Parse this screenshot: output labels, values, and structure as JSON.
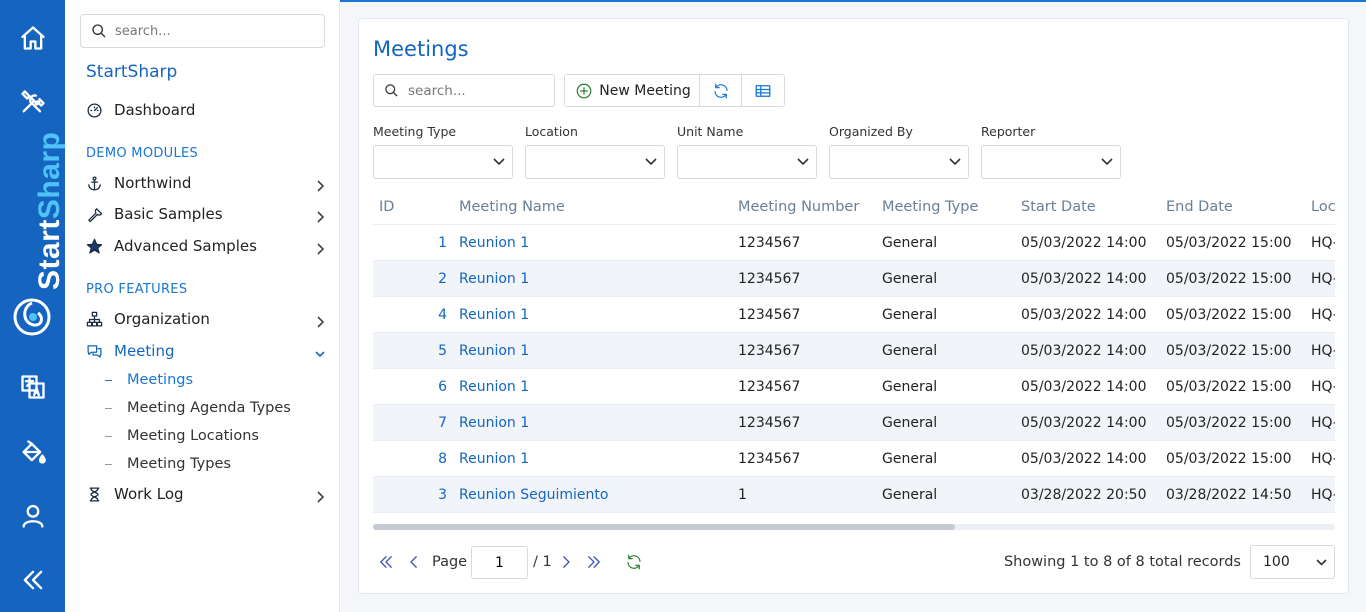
{
  "brand": {
    "name_part1": "Start",
    "name_part2": "Sharp"
  },
  "sidebar": {
    "search_placeholder": "search...",
    "app_title": "StartSharp",
    "dashboard_label": "Dashboard",
    "demo_header": "DEMO MODULES",
    "pro_header": "PRO FEATURES",
    "items": [
      {
        "label": "Northwind",
        "icon": "anchor-icon"
      },
      {
        "label": "Basic Samples",
        "icon": "wrench-icon"
      },
      {
        "label": "Advanced Samples",
        "icon": "star-icon"
      },
      {
        "label": "Organization",
        "icon": "sitemap-icon"
      },
      {
        "label": "Meeting",
        "icon": "comments-icon",
        "expanded": true
      },
      {
        "label": "Work Log",
        "icon": "hourglass-icon"
      }
    ],
    "meeting_sub": [
      "Meetings",
      "Meeting Agenda Types",
      "Meeting Locations",
      "Meeting Types"
    ]
  },
  "main": {
    "title": "Meetings",
    "search_placeholder": "search...",
    "new_button": "New Meeting",
    "filters": [
      "Meeting Type",
      "Location",
      "Unit Name",
      "Organized By",
      "Reporter"
    ],
    "columns": [
      "ID",
      "Meeting Name",
      "Meeting Number",
      "Meeting Type",
      "Start Date",
      "End Date",
      "Loc"
    ],
    "rows": [
      {
        "id": "1",
        "name": "Reunion 1",
        "number": "1234567",
        "type": "General",
        "start": "05/03/2022 14:00",
        "end": "05/03/2022 15:00",
        "loc": "HQ-"
      },
      {
        "id": "2",
        "name": "Reunion 1",
        "number": "1234567",
        "type": "General",
        "start": "05/03/2022 14:00",
        "end": "05/03/2022 15:00",
        "loc": "HQ-"
      },
      {
        "id": "4",
        "name": "Reunion 1",
        "number": "1234567",
        "type": "General",
        "start": "05/03/2022 14:00",
        "end": "05/03/2022 15:00",
        "loc": "HQ-"
      },
      {
        "id": "5",
        "name": "Reunion 1",
        "number": "1234567",
        "type": "General",
        "start": "05/03/2022 14:00",
        "end": "05/03/2022 15:00",
        "loc": "HQ-"
      },
      {
        "id": "6",
        "name": "Reunion 1",
        "number": "1234567",
        "type": "General",
        "start": "05/03/2022 14:00",
        "end": "05/03/2022 15:00",
        "loc": "HQ-"
      },
      {
        "id": "7",
        "name": "Reunion 1",
        "number": "1234567",
        "type": "General",
        "start": "05/03/2022 14:00",
        "end": "05/03/2022 15:00",
        "loc": "HQ-"
      },
      {
        "id": "8",
        "name": "Reunion 1",
        "number": "1234567",
        "type": "General",
        "start": "05/03/2022 14:00",
        "end": "05/03/2022 15:00",
        "loc": "HQ-"
      },
      {
        "id": "3",
        "name": "Reunion Seguimiento",
        "number": "1",
        "type": "General",
        "start": "03/28/2022 20:50",
        "end": "03/28/2022 14:50",
        "loc": "HQ-"
      }
    ]
  },
  "pager": {
    "page_label": "Page",
    "page_value": "1",
    "page_total": "/ 1",
    "status": "Showing 1 to 8 of 8 total records",
    "page_size": "100"
  },
  "colors": {
    "rail": "#1565c0",
    "accent": "#1976d2",
    "link": "#1565c0",
    "row_alt": "#f1f4f8"
  }
}
